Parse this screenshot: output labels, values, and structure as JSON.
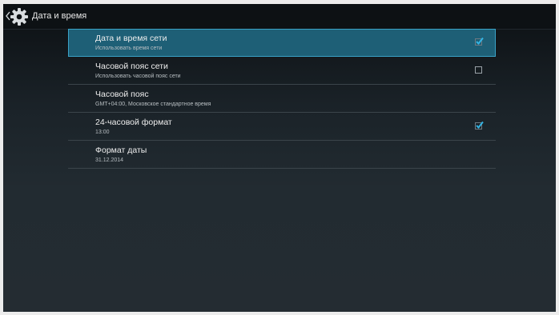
{
  "header": {
    "title": "Дата и время"
  },
  "settings": {
    "items": [
      {
        "title": "Дата и время сети",
        "summary": "Использовать время сети",
        "checkbox": true,
        "checked": true,
        "selected": true
      },
      {
        "title": "Часовой пояс сети",
        "summary": "Использовать часовой пояс сети",
        "checkbox": true,
        "checked": false,
        "selected": false
      },
      {
        "title": "Часовой пояс",
        "summary": "GMT+04:00, Московское стандартное время",
        "checkbox": false,
        "checked": false,
        "selected": false
      },
      {
        "title": "24-часовой формат",
        "summary": "13:00",
        "checkbox": true,
        "checked": true,
        "selected": false
      },
      {
        "title": "Формат даты",
        "summary": "31.12.2014",
        "checkbox": false,
        "checked": false,
        "selected": false
      }
    ]
  },
  "colors": {
    "accent_selected": "#1e5f76",
    "accent_border": "#3aa3c8",
    "check": "#33b5e5"
  },
  "icons": {
    "back": "chevron-left-icon",
    "settings": "gear-icon",
    "check": "checkmark-icon"
  }
}
